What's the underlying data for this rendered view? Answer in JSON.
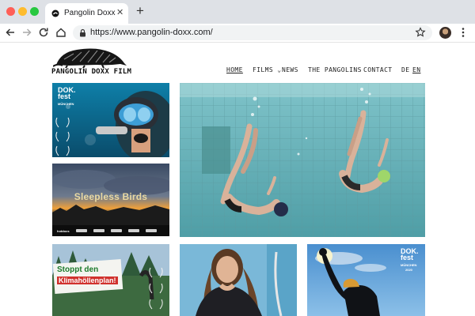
{
  "browser": {
    "tab_title": "Pangolin Doxx",
    "close_symbol": "✕",
    "new_tab_symbol": "+",
    "url": "https://www.pangolin-doxx.com/",
    "icons": [
      "back-arrow-icon",
      "forward-arrow-icon",
      "reload-icon",
      "home-icon",
      "lock-icon",
      "bookmark-star-icon",
      "profile-avatar",
      "more-menu-icon"
    ],
    "window_controls": {
      "close": "#ff5f57",
      "minimize": "#febc2e",
      "maximize": "#28c840"
    }
  },
  "site": {
    "logo_text": "PANGOLIN DOXX FILM",
    "nav": {
      "home": "HOME",
      "films": "FILMS ⌄",
      "news": "NEWS",
      "pangolins": "THE PANGOLINS",
      "contact": "CONTACT",
      "lang_de": "DE",
      "lang_en": "EN"
    }
  },
  "tiles": {
    "diver": {
      "dok_line1": "DOK.",
      "dok_line2": "fest",
      "dok_city": "MÜNCHEN"
    },
    "birds": {
      "title": "Sleepless Birds",
      "logo": "hotdocs"
    },
    "klima": {
      "line1": "Stoppt den",
      "line2": "Klimahöllenplan!"
    },
    "raise": {
      "dok_line1": "DOK.",
      "dok_line2": "fest",
      "dok_city": "MÜNCHEN",
      "dok_year": "2020"
    }
  }
}
